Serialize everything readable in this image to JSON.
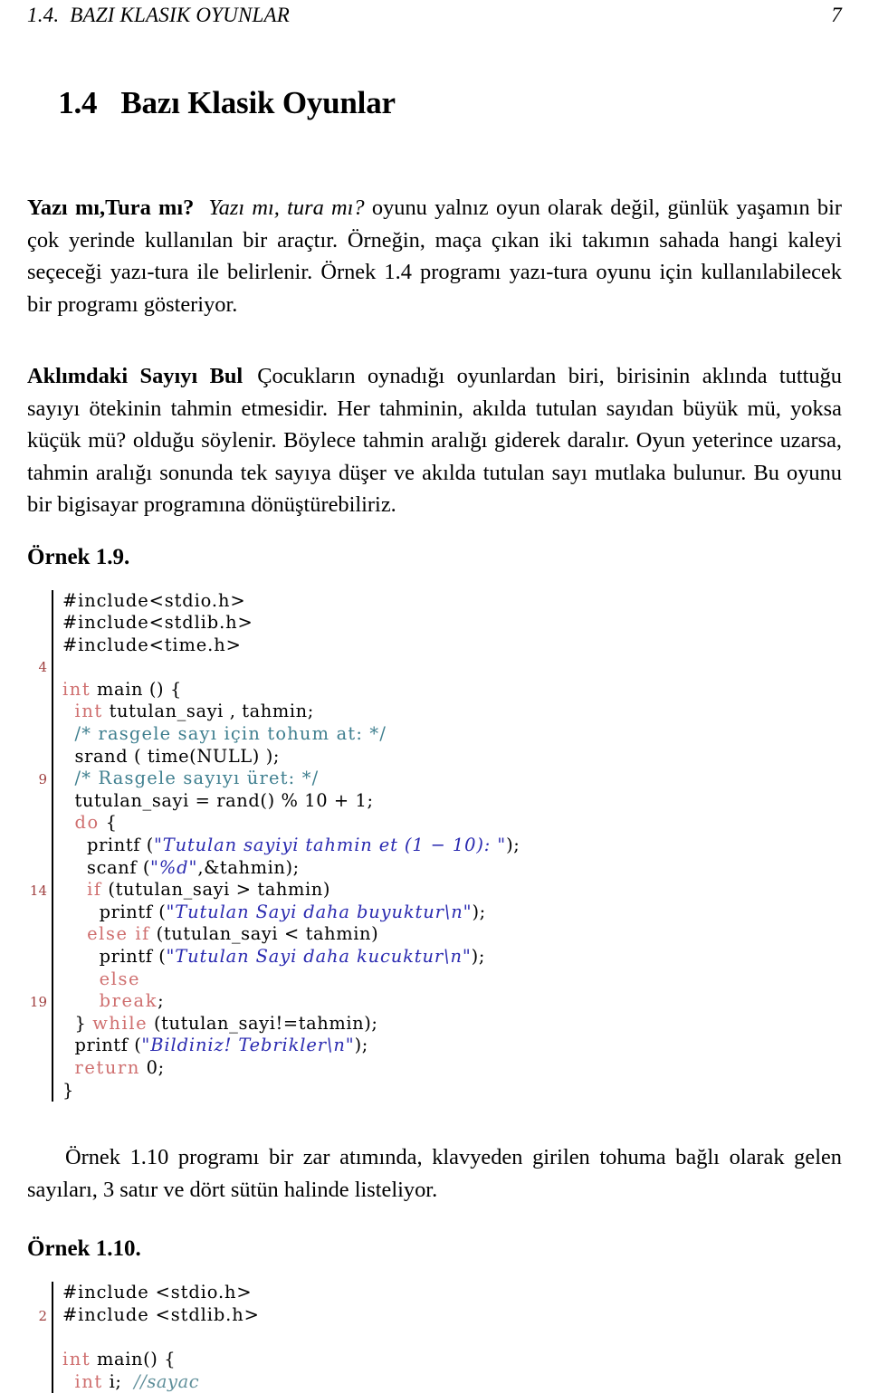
{
  "header": {
    "left": "1.4.  BAZI KLASIK OYUNLAR",
    "page_number": "7"
  },
  "section": {
    "number": "1.4",
    "title": "Bazı Klasik Oyunlar"
  },
  "paragraphs": {
    "p1": {
      "lead": "Yazı mı,Tura mı?",
      "italic_part": "Yazı mı, tura mı?",
      "rest": " oyunu yalnız oyun olarak değil, günlük yaşamın bir çok yerinde kullanılan bir araçtır. Örneğin, maça çıkan iki takımın sahada hangi kaleyi seçeceği yazı-tura ile belirlenir. Örnek 1.4 programı yazı-tura oyunu için kullanılabilecek bir programı gösteriyor."
    },
    "p2": {
      "lead": "Aklımdaki Sayıyı Bul",
      "rest": "Çocukların oynadığı oyunlardan biri, birisinin aklında tuttuğu sayıyı ötekinin tahmin etmesidir. Her tahminin, akılda tutulan sayıdan büyük mü, yoksa küçük mü? olduğu söylenir. Böylece tahmin aralığı giderek daralır. Oyun yeterince uzarsa, tahmin aralığı sonunda tek sayıya düşer ve akılda tutulan sayı mutlaka bulunur. Bu oyunu bir bigisayar programına dönüştürebiliriz."
    },
    "p3": "Örnek 1.10 programı bir zar atımında, klavyeden girilen tohuma bağlı olarak gelen sayıları, 3 satır ve dört sütün halinde listeliyor."
  },
  "examples": {
    "ex19_label": "Örnek 1.9.",
    "ex110_label": "Örnek 1.10."
  },
  "listing1": {
    "lines": [
      {
        "no": "",
        "parts": [
          {
            "t": "#include<stdio.h>",
            "c": "pp"
          }
        ]
      },
      {
        "no": "",
        "parts": [
          {
            "t": "#include<stdlib.h>",
            "c": "pp"
          }
        ]
      },
      {
        "no": "",
        "parts": [
          {
            "t": "#include<time.h>",
            "c": "pp"
          }
        ]
      },
      {
        "no": "4",
        "parts": [
          {
            "t": "",
            "c": ""
          }
        ]
      },
      {
        "no": "",
        "parts": [
          {
            "t": "int",
            "c": "kw"
          },
          {
            "t": " main () {",
            "c": ""
          }
        ]
      },
      {
        "no": "",
        "parts": [
          {
            "t": "  ",
            "c": ""
          },
          {
            "t": "int",
            "c": "kw"
          },
          {
            "t": " tutulan_sayi , tahmin;",
            "c": ""
          }
        ]
      },
      {
        "no": "",
        "parts": [
          {
            "t": "  ",
            "c": ""
          },
          {
            "t": "/* rasgele sayı için tohum at: */",
            "c": "cmt"
          }
        ]
      },
      {
        "no": "",
        "parts": [
          {
            "t": "  srand ( time(NULL) );",
            "c": ""
          }
        ]
      },
      {
        "no": "9",
        "parts": [
          {
            "t": "  ",
            "c": ""
          },
          {
            "t": "/* Rasgele sayıyı üret: */",
            "c": "cmt"
          }
        ]
      },
      {
        "no": "",
        "parts": [
          {
            "t": "  tutulan_sayi = rand() % 10 + 1;",
            "c": ""
          }
        ]
      },
      {
        "no": "",
        "parts": [
          {
            "t": "  ",
            "c": ""
          },
          {
            "t": "do",
            "c": "kw"
          },
          {
            "t": " {",
            "c": ""
          }
        ]
      },
      {
        "no": "",
        "parts": [
          {
            "t": "    printf (",
            "c": ""
          },
          {
            "t": "\"Tutulan sayiyi tahmin et (1 − 10): \"",
            "c": "str"
          },
          {
            "t": ");",
            "c": ""
          }
        ]
      },
      {
        "no": "",
        "parts": [
          {
            "t": "    scanf (",
            "c": ""
          },
          {
            "t": "\"%d\"",
            "c": "str"
          },
          {
            "t": ",&tahmin);",
            "c": ""
          }
        ]
      },
      {
        "no": "14",
        "parts": [
          {
            "t": "    ",
            "c": ""
          },
          {
            "t": "if",
            "c": "kw"
          },
          {
            "t": " (tutulan_sayi > tahmin)",
            "c": ""
          }
        ]
      },
      {
        "no": "",
        "parts": [
          {
            "t": "      printf (",
            "c": ""
          },
          {
            "t": "\"Tutulan Sayi daha buyuktur\\n\"",
            "c": "str"
          },
          {
            "t": ");",
            "c": ""
          }
        ]
      },
      {
        "no": "",
        "parts": [
          {
            "t": "    ",
            "c": ""
          },
          {
            "t": "else if",
            "c": "kw"
          },
          {
            "t": " (tutulan_sayi < tahmin)",
            "c": ""
          }
        ]
      },
      {
        "no": "",
        "parts": [
          {
            "t": "      printf (",
            "c": ""
          },
          {
            "t": "\"Tutulan Sayi daha kucuktur\\n\"",
            "c": "str"
          },
          {
            "t": ");",
            "c": ""
          }
        ]
      },
      {
        "no": "",
        "parts": [
          {
            "t": "      ",
            "c": ""
          },
          {
            "t": "else",
            "c": "kw"
          }
        ]
      },
      {
        "no": "19",
        "parts": [
          {
            "t": "      ",
            "c": ""
          },
          {
            "t": "break",
            "c": "kw"
          },
          {
            "t": ";",
            "c": ""
          }
        ]
      },
      {
        "no": "",
        "parts": [
          {
            "t": "  } ",
            "c": ""
          },
          {
            "t": "while",
            "c": "kw"
          },
          {
            "t": " (tutulan_sayi!=tahmin);",
            "c": ""
          }
        ]
      },
      {
        "no": "",
        "parts": [
          {
            "t": "  printf (",
            "c": ""
          },
          {
            "t": "\"Bildiniz! Tebrikler\\n\"",
            "c": "str"
          },
          {
            "t": ");",
            "c": ""
          }
        ]
      },
      {
        "no": "",
        "parts": [
          {
            "t": "  ",
            "c": ""
          },
          {
            "t": "return",
            "c": "kw"
          },
          {
            "t": " 0;",
            "c": ""
          }
        ]
      },
      {
        "no": "",
        "parts": [
          {
            "t": "}",
            "c": ""
          }
        ]
      }
    ]
  },
  "listing2": {
    "lines": [
      {
        "no": "",
        "parts": [
          {
            "t": "#include <stdio.h>",
            "c": "pp"
          }
        ]
      },
      {
        "no": "2",
        "parts": [
          {
            "t": "#include <stdlib.h>",
            "c": "pp"
          }
        ]
      },
      {
        "no": "",
        "parts": [
          {
            "t": "",
            "c": ""
          }
        ]
      },
      {
        "no": "",
        "parts": [
          {
            "t": "int",
            "c": "kw"
          },
          {
            "t": " main() {",
            "c": ""
          }
        ]
      },
      {
        "no": "",
        "parts": [
          {
            "t": "  ",
            "c": ""
          },
          {
            "t": "int",
            "c": "kw"
          },
          {
            "t": " i;  ",
            "c": ""
          },
          {
            "t": "//sayac",
            "c": "cmt2"
          }
        ]
      }
    ]
  }
}
